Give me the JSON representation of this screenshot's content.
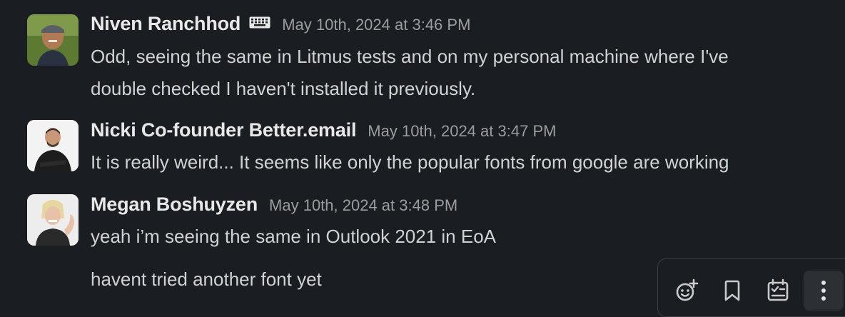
{
  "messages": [
    {
      "author": "Niven Ranchhod",
      "timestamp": "May 10th, 2024 at 3:46 PM",
      "status_icon": "keyboard-icon",
      "lines": [
        "Odd, seeing the same in Litmus tests and on my personal machine where I've",
        "double checked I haven't installed it previously."
      ]
    },
    {
      "author": "Nicki Co-founder Better.email",
      "timestamp": "May 10th, 2024 at 3:47 PM",
      "lines": [
        "It is really weird... It seems like only the popular fonts from google are working"
      ]
    },
    {
      "author": "Megan Boshuyzen",
      "timestamp": "May 10th, 2024 at 3:48 PM",
      "lines": [
        "yeah i’m seeing the same in Outlook 2021 in EoA"
      ]
    },
    {
      "continuation": true,
      "lines": [
        "havent tried another font yet"
      ]
    }
  ],
  "message_actions": [
    {
      "icon": "add-reaction-icon"
    },
    {
      "icon": "bookmark-icon"
    },
    {
      "icon": "checklist-icon"
    },
    {
      "icon": "more-actions-icon"
    }
  ]
}
